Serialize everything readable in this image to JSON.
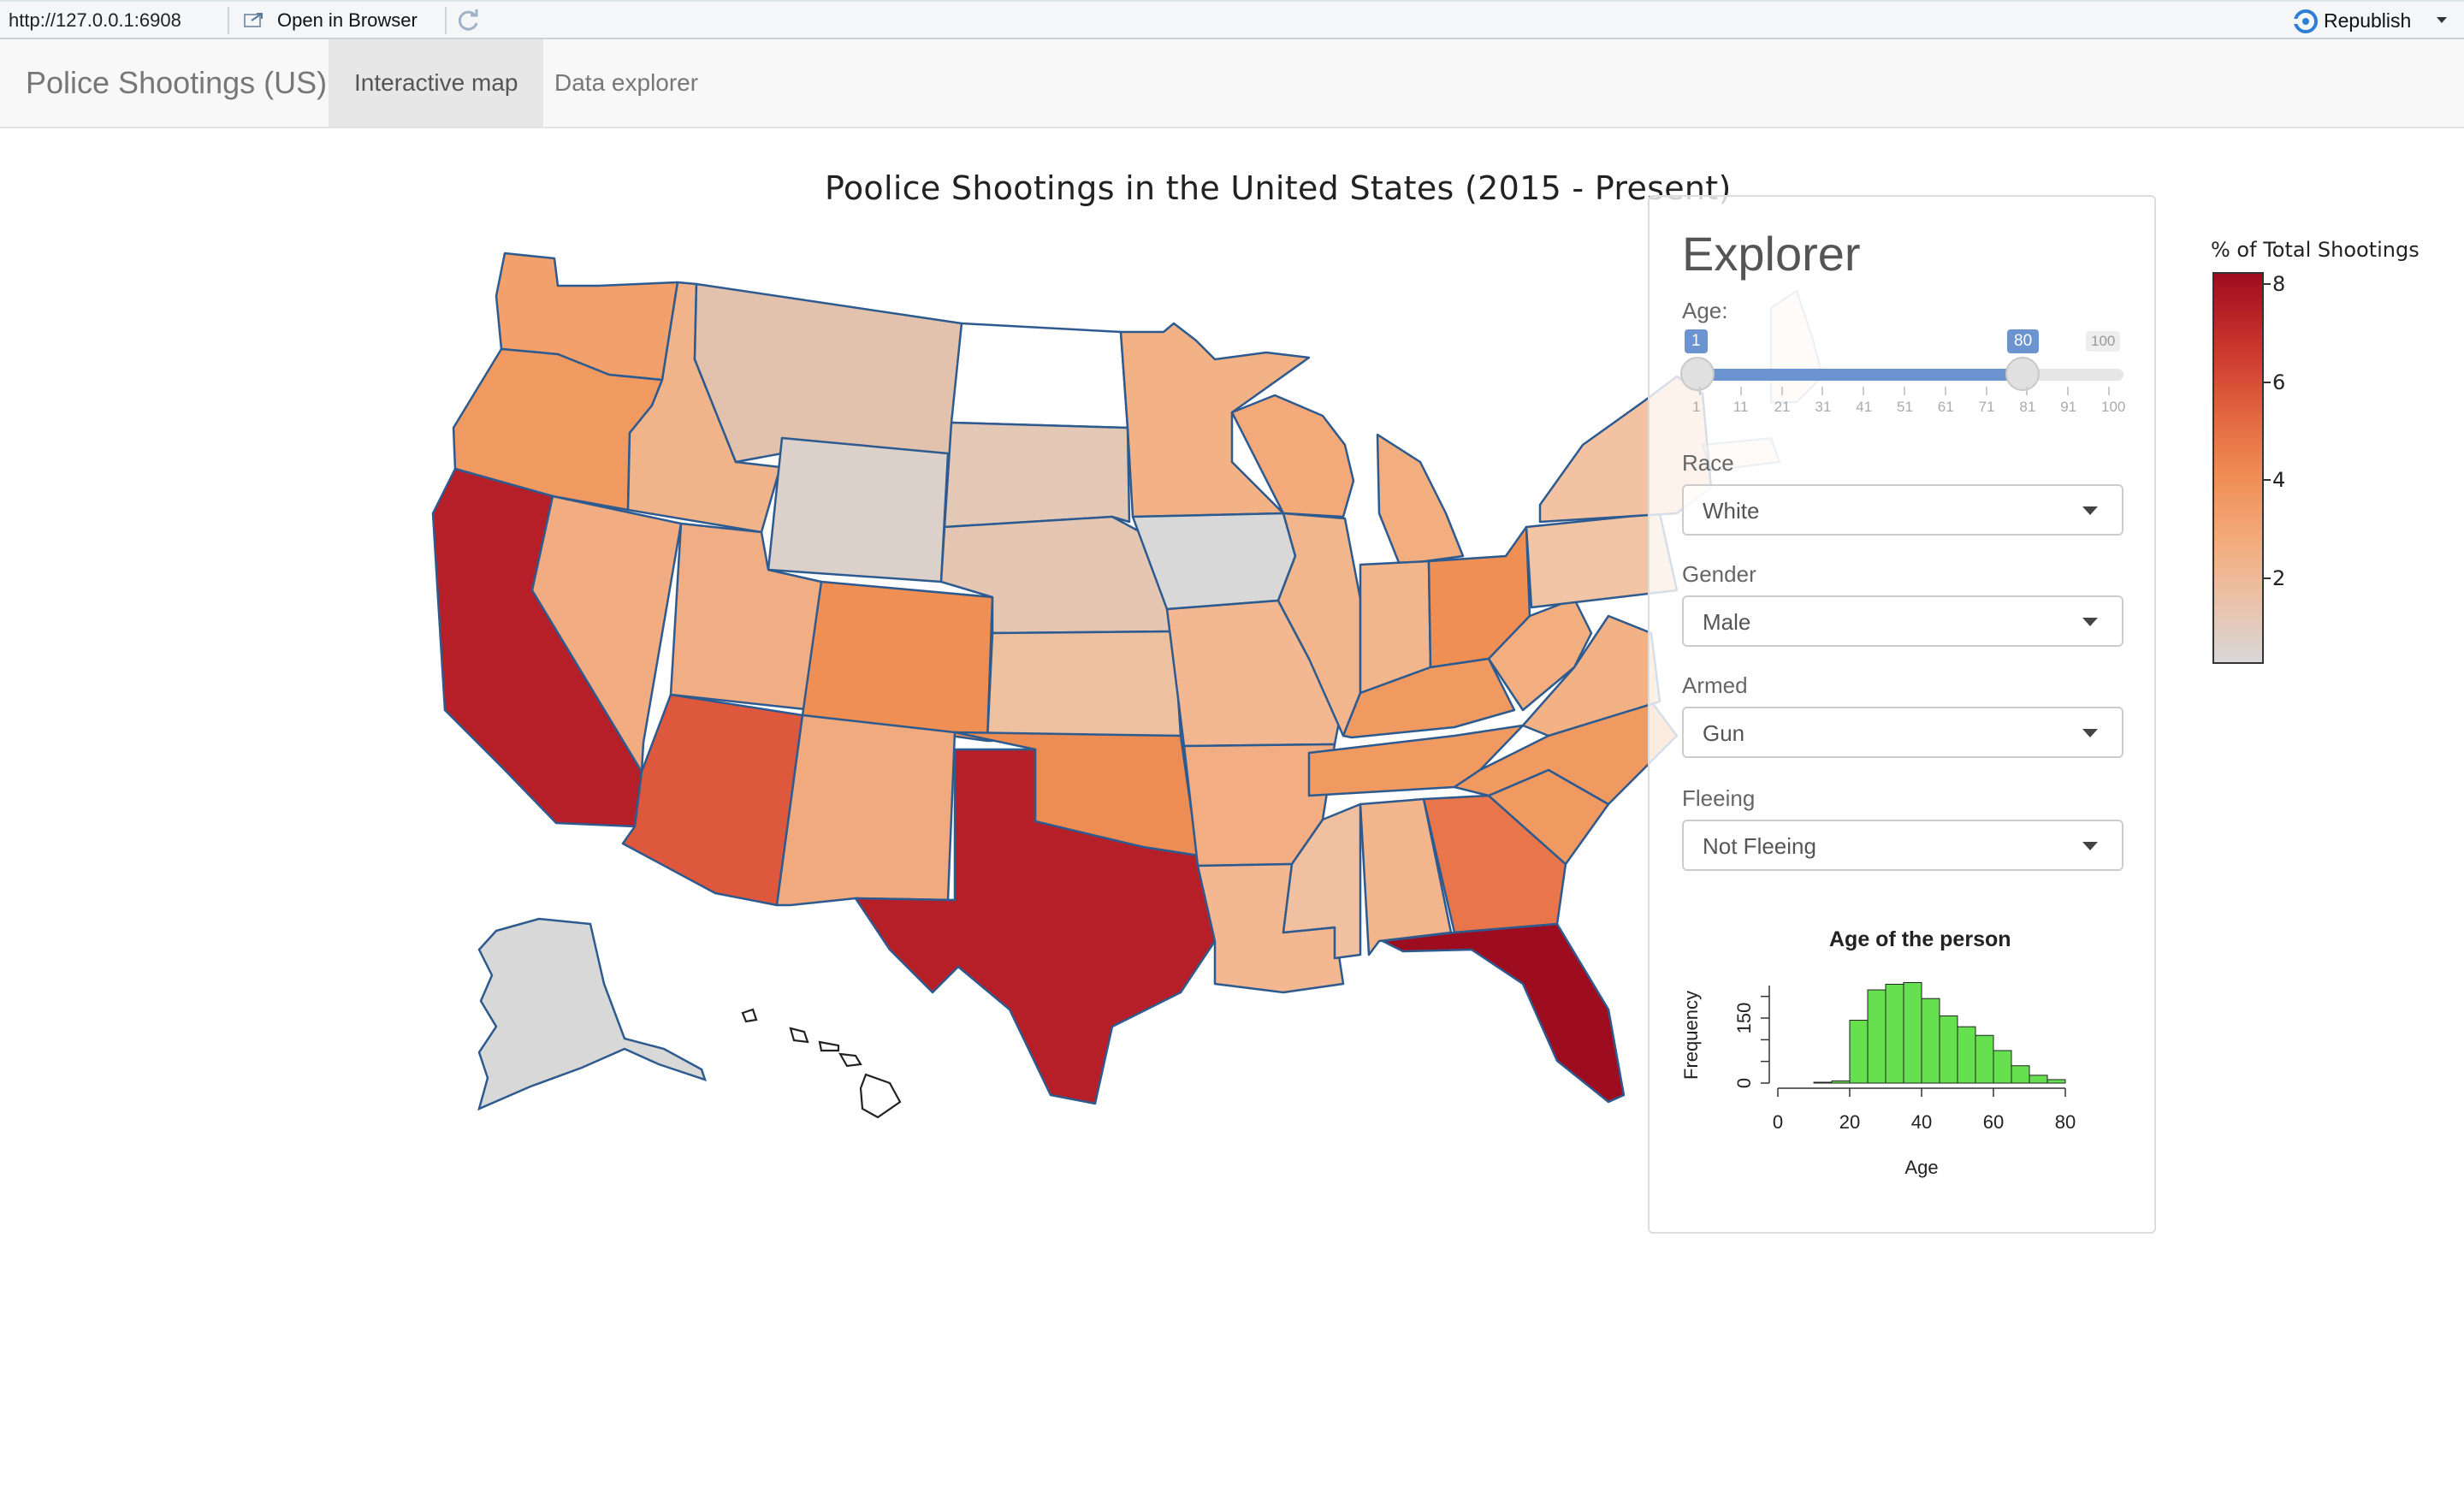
{
  "viewer": {
    "url": "http://127.0.0.1:6908",
    "open_in_browser": "Open in Browser",
    "republish": "Republish"
  },
  "navbar": {
    "brand": "Police Shootings (US)",
    "tabs": [
      {
        "label": "Interactive map",
        "active": true
      },
      {
        "label": "Data explorer",
        "active": false
      }
    ]
  },
  "map": {
    "title": "Poolice Shootings in the United States (2015 - Present)",
    "legend": {
      "title": "% of Total Shootings",
      "ticks": [
        "8",
        "6",
        "4",
        "2"
      ],
      "colors": {
        "high": "#9e0c1f",
        "mid": "#f08d54",
        "low": "#d8d8d8"
      }
    }
  },
  "explorer": {
    "title": "Explorer",
    "age": {
      "label": "Age:",
      "min": "1",
      "max": "100",
      "from": "1",
      "to": "80",
      "grid": [
        "1",
        "11",
        "21",
        "31",
        "41",
        "51",
        "61",
        "71",
        "81",
        "91",
        "100"
      ]
    },
    "race": {
      "label": "Race",
      "value": "White"
    },
    "gender": {
      "label": "Gender",
      "value": "Male"
    },
    "armed": {
      "label": "Armed",
      "value": "Gun"
    },
    "fleeing": {
      "label": "Fleeing",
      "value": "Not Fleeing"
    }
  },
  "chart_data": {
    "type": "bar",
    "title": "Age of the person",
    "xlabel": "Age",
    "ylabel": "Frequency",
    "x_ticks": [
      "0",
      "20",
      "40",
      "60",
      "80"
    ],
    "y_ticks": [
      "0",
      "150"
    ],
    "xlim": [
      0,
      80
    ],
    "ylim": [
      0,
      225
    ],
    "bar_color": "#66e04f",
    "bins": [
      10,
      15,
      20,
      25,
      30,
      35,
      40,
      45,
      50,
      55,
      60,
      65,
      70,
      75
    ],
    "bin_width": 5,
    "values": [
      2,
      5,
      145,
      215,
      228,
      232,
      195,
      155,
      130,
      110,
      75,
      40,
      18,
      8
    ]
  }
}
